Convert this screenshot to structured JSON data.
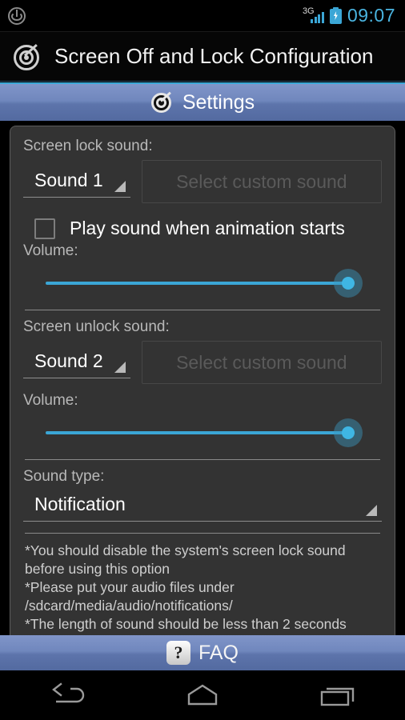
{
  "statusbar": {
    "power_icon": "power-icon",
    "network_type": "3G",
    "signal_icon": "signal-bars-icon",
    "battery_icon": "battery-charging-icon",
    "time": "09:07"
  },
  "titlebar": {
    "app_icon": "target-icon",
    "title": "Screen Off and Lock Configuration"
  },
  "settings_header": {
    "icon": "target-icon",
    "title": "Settings"
  },
  "lock_section": {
    "label": "Screen lock sound:",
    "sound_value": "Sound 1",
    "custom_sound_button": "Select custom sound",
    "checkbox_label": "Play sound when animation starts",
    "checkbox_checked": false,
    "volume_label": "Volume:",
    "volume_percent": 100
  },
  "unlock_section": {
    "label": "Screen unlock sound:",
    "sound_value": "Sound 2",
    "custom_sound_button": "Select custom sound",
    "volume_label": "Volume:",
    "volume_percent": 100
  },
  "sound_type_section": {
    "label": "Sound type:",
    "value": "Notification"
  },
  "notes": {
    "line1": "*You should disable the system's screen lock sound before using this option",
    "line2": "*Please put your audio files under /sdcard/media/audio/notifications/",
    "line3": "*The length of sound should be less than 2 seconds"
  },
  "faq": {
    "icon": "question-mark-icon",
    "icon_glyph": "?",
    "label": "FAQ"
  },
  "navbar": {
    "back": "back-icon",
    "home": "home-icon",
    "recents": "recent-apps-icon"
  },
  "colors": {
    "accent_blue": "#3ba6d6",
    "header_blue": "#7087bd",
    "panel_bg": "#333333",
    "clock_blue": "#4ab4e0"
  }
}
